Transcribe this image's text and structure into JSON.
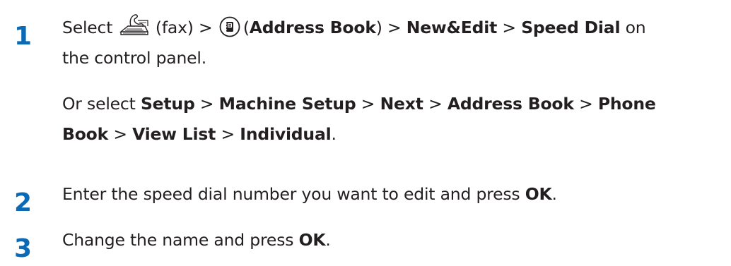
{
  "steps": [
    {
      "number": "1",
      "line1": {
        "select": "Select",
        "fax_label": "(fax) >",
        "paren_open": "(",
        "address_book": "Address Book",
        "paren_close_sep": ") >",
        "new_edit": "New&Edit",
        "sep": ">",
        "speed_dial": "Speed Dial",
        "on": "on"
      },
      "line2": "the control panel.",
      "alt": {
        "prefix": "Or select",
        "setup": "Setup",
        "machine_setup": "Machine Setup",
        "next": "Next",
        "address_book": "Address Book",
        "phone": "Phone",
        "book": "Book",
        "view_list": "View List",
        "individual": "Individual",
        "sep": ">",
        "period": "."
      }
    },
    {
      "number": "2",
      "text": "Enter the speed dial number you want to edit and press",
      "ok": "OK",
      "period": "."
    },
    {
      "number": "3",
      "text": "Change the name and press",
      "ok": "OK",
      "period": "."
    }
  ],
  "icons": {
    "fax": "fax-icon",
    "address_book": "address-book-icon"
  },
  "colors": {
    "step_number": "#0a6ab5",
    "text": "#231f20"
  }
}
